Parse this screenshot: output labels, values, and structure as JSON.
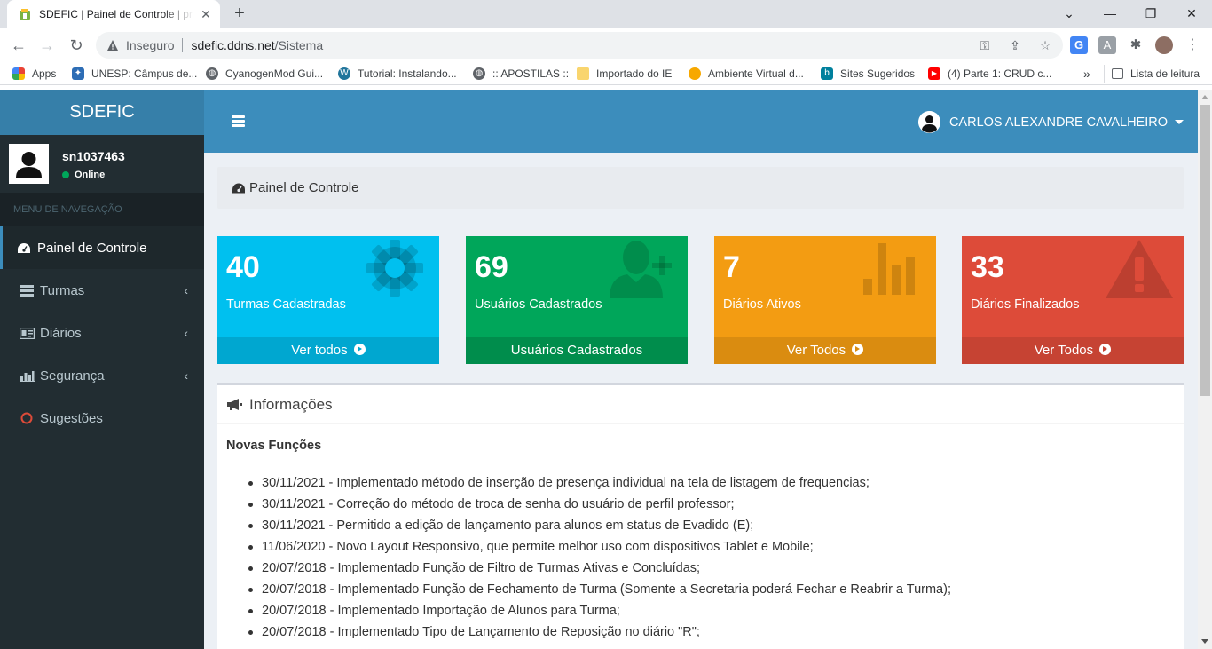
{
  "browser": {
    "tab_title": "SDEFIC | Painel de Controle | professor",
    "insecure_label": "Inseguro",
    "url_host": "sdefic.ddns.net",
    "url_path": "/Sistema",
    "bookmarks": [
      {
        "label": "Apps",
        "icon": "apps-grid-icon"
      },
      {
        "label": "UNESP: Câmpus de...",
        "icon": "unesp-icon"
      },
      {
        "label": "CyanogenMod Gui...",
        "icon": "globe-icon"
      },
      {
        "label": "Tutorial: Instalando...",
        "icon": "wordpress-icon"
      },
      {
        "label": ":: APOSTILAS ::",
        "icon": "globe-icon"
      },
      {
        "label": "Importado do IE",
        "icon": "folder-icon"
      },
      {
        "label": "Ambiente Virtual d...",
        "icon": "moodle-icon"
      },
      {
        "label": "Sites Sugeridos",
        "icon": "bing-icon"
      },
      {
        "label": "(4) Parte 1: CRUD c...",
        "icon": "youtube-icon"
      }
    ],
    "overflow_label": "»",
    "reading_list_label": "Lista de leitura"
  },
  "sidebar": {
    "logo": "SDEFIC",
    "username": "sn1037463",
    "status": "Online",
    "menu_header": "MENU DE NAVEGAÇÃO",
    "items": [
      {
        "label": "Painel de Controle",
        "icon": "dashboard-icon",
        "active": true
      },
      {
        "label": "Turmas",
        "icon": "list-icon"
      },
      {
        "label": "Diários",
        "icon": "id-card-icon"
      },
      {
        "label": "Segurança",
        "icon": "bar-chart-icon"
      },
      {
        "label": "Sugestões",
        "icon": "circle-icon"
      }
    ]
  },
  "header": {
    "user_name": "CARLOS ALEXANDRE CAVALHEIRO"
  },
  "breadcrumb": "Painel de Controle",
  "stats": [
    {
      "number": "40",
      "label": "Turmas Cadastradas",
      "footer": "Ver todos",
      "color": "#00c0ef",
      "foot_color": "#00a7d0",
      "icon": "gear-icon"
    },
    {
      "number": "69",
      "label": "Usuários Cadastrados",
      "footer": "Usuários Cadastrados",
      "color": "#00a65a",
      "foot_color": "#008d4c",
      "icon": "user-plus-icon"
    },
    {
      "number": "7",
      "label": "Diários Ativos",
      "footer": "Ver Todos",
      "color": "#f39c12",
      "foot_color": "#da8c10",
      "icon": "bar-chart-icon"
    },
    {
      "number": "33",
      "label": "Diários Finalizados",
      "footer": "Ver Todos",
      "color": "#dd4b39",
      "foot_color": "#c64333",
      "icon": "warning-icon"
    }
  ],
  "info": {
    "title": "Informações",
    "subtitle": "Novas Funções",
    "items": [
      "30/11/2021 - Implementado método de inserção de presença individual na tela de listagem de frequencias;",
      "30/11/2021 - Correção do método de troca de senha do usuário de perfil professor;",
      "30/11/2021 - Permitido a edição de lançamento para alunos em status de Evadido (E);",
      "11/06/2020 - Novo Layout Responsivo, que permite melhor uso com dispositivos Tablet e Mobile;",
      "20/07/2018 - Implementado Função de Filtro de Turmas Ativas e Concluídas;",
      "20/07/2018 - Implementado Função de Fechamento de Turma (Somente a Secretaria poderá Fechar e Reabrir a Turma);",
      "20/07/2018 - Implementado Importação de Alunos para Turma;",
      "20/07/2018 - Implementado Tipo de Lançamento de Reposição no diário \"R\";"
    ]
  }
}
